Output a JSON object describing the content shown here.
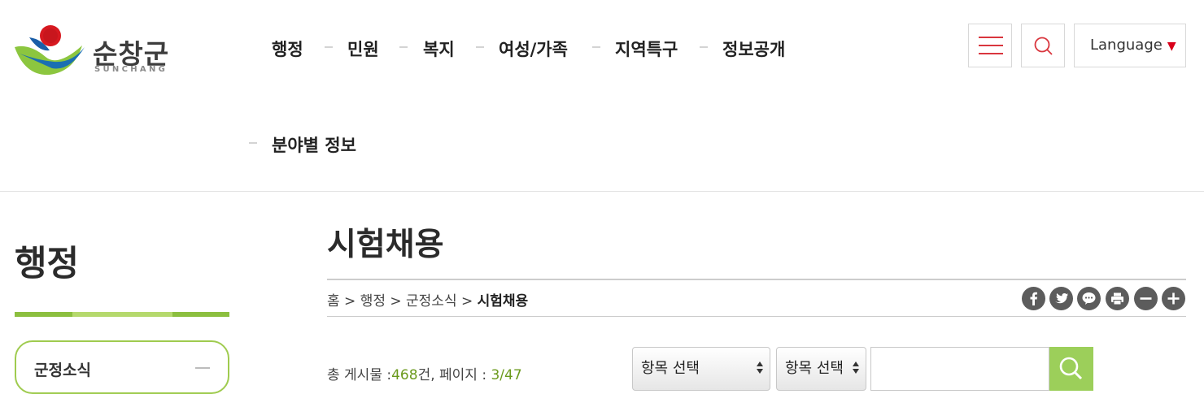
{
  "logo": {
    "text": "순창군",
    "sub": "SUNCHANG"
  },
  "gnb": {
    "items": [
      "행정",
      "민원",
      "복지",
      "여성/가족",
      "지역특구",
      "정보공개",
      "분야별 정보"
    ]
  },
  "header_buttons": {
    "language": "Language",
    "language_caret": "▼"
  },
  "sidebar": {
    "title": "행정",
    "menu": [
      {
        "label": "군정소식"
      }
    ]
  },
  "page": {
    "title": "시험채용",
    "breadcrumb": {
      "path": "홈 > 행정 > 군정소식 > ",
      "current": "시험채용"
    }
  },
  "board": {
    "count_prefix": "총 게시물 :",
    "count": "468",
    "count_suffix": "건, 페이지 : ",
    "page": "3/47"
  },
  "search": {
    "select1": "항목 선택",
    "select2": "항목 선택",
    "query": ""
  },
  "colors": {
    "accent_green": "#9ccf5a",
    "brand_red": "#d9363e",
    "count_green": "#6b9a1d"
  },
  "icons": [
    "facebook-icon",
    "twitter-icon",
    "kakao-story-icon",
    "print-icon",
    "zoom-out-icon",
    "zoom-in-icon",
    "search-icon",
    "hamburger-menu-icon"
  ]
}
